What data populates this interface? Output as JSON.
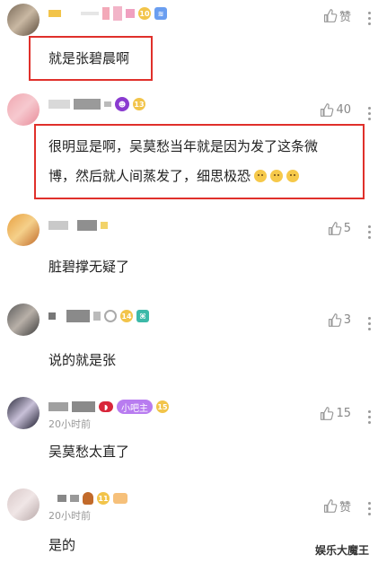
{
  "comments": [
    {
      "text": "就是张碧晨啊",
      "time": "",
      "like_label": "赞",
      "highlighted": true
    },
    {
      "text_line1": "很明显是啊，吴莫愁当年就是因为发了这条微",
      "text_line2": "博，然后就人间蒸发了，细思极恐",
      "time": "",
      "like_label": "40",
      "highlighted": true
    },
    {
      "text": "脏碧撑无疑了",
      "time": "",
      "like_label": "5"
    },
    {
      "text": "说的就是张",
      "time": "",
      "like_label": "3"
    },
    {
      "text": "吴莫愁太直了",
      "time": "20小时前",
      "tag": "小吧主",
      "like_label": "15"
    },
    {
      "text": "是的",
      "time": "20小时前",
      "like_label": "赞"
    }
  ],
  "watermark": "娱乐大魔王",
  "colors": {
    "highlight_border": "#e0302b",
    "meta_gray": "#999999",
    "like_gray": "#888888",
    "tag_purple": "#b87cf0"
  },
  "icons": [
    "thumbs-up-icon",
    "more-vertical-icon",
    "level-badge-icon",
    "emoji-icon"
  ]
}
